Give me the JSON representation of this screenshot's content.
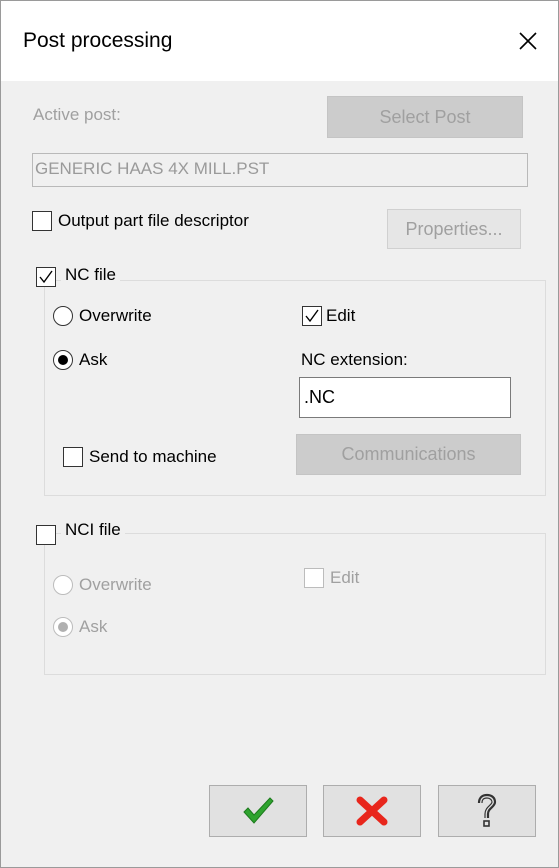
{
  "dialog": {
    "title": "Post processing"
  },
  "active_post": {
    "label": "Active post:",
    "select_button": "Select Post",
    "value": "GENERIC HAAS 4X MILL.PST"
  },
  "output_descriptor": {
    "label": "Output part file descriptor",
    "checked": false,
    "properties_button": "Properties..."
  },
  "nc_file": {
    "label": "NC file",
    "checked": true,
    "overwrite_label": "Overwrite",
    "ask_label": "Ask",
    "selected": "Ask",
    "edit_label": "Edit",
    "edit_checked": true,
    "extension_label": "NC extension:",
    "extension_value": ".NC",
    "send_label": "Send to machine",
    "send_checked": false,
    "communications_button": "Communications"
  },
  "nci_file": {
    "label": "NCI file",
    "checked": false,
    "overwrite_label": "Overwrite",
    "ask_label": "Ask",
    "selected": "Ask",
    "edit_label": "Edit",
    "edit_checked": false
  },
  "footer": {
    "ok_icon": "green-checkmark-icon",
    "cancel_icon": "red-x-icon",
    "help_icon": "question-mark-icon"
  },
  "colors": {
    "ok_green": "#2fa32f",
    "cancel_red": "#e8261c",
    "disabled_text": "#a0a0a0"
  }
}
